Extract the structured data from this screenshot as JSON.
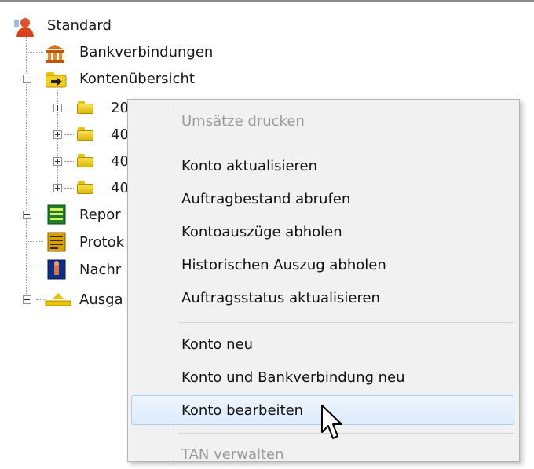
{
  "tree": {
    "root": {
      "label": "Standard",
      "icon": "person-icon"
    },
    "items": [
      {
        "label": "Bankverbindungen",
        "icon": "bank-icon"
      },
      {
        "label": "Kontenübersicht",
        "icon": "folder-arrow-icon"
      },
      {
        "label": "20",
        "icon": "folder-icon"
      },
      {
        "label": "40",
        "icon": "folder-icon"
      },
      {
        "label": "40",
        "icon": "folder-icon"
      },
      {
        "label": "40",
        "icon": "folder-icon"
      },
      {
        "label": "Repor",
        "icon": "report-icon"
      },
      {
        "label": "Protok",
        "icon": "protocol-icon"
      },
      {
        "label": "Nachr",
        "icon": "message-icon"
      },
      {
        "label": "Ausga",
        "icon": "outbox-icon"
      }
    ]
  },
  "context_menu": {
    "items": [
      {
        "label": "Umsätze drucken",
        "state": "disabled"
      },
      {
        "label": "Konto aktualisieren",
        "state": "normal"
      },
      {
        "label": "Auftragbestand abrufen",
        "state": "normal"
      },
      {
        "label": "Kontoauszüge abholen",
        "state": "normal"
      },
      {
        "label": "Historischen Auszug abholen",
        "state": "normal"
      },
      {
        "label": "Auftragsstatus aktualisieren",
        "state": "normal"
      },
      {
        "label": "Konto neu",
        "state": "normal"
      },
      {
        "label": "Konto und Bankverbindung neu",
        "state": "normal"
      },
      {
        "label": "Konto bearbeiten",
        "state": "highlighted"
      },
      {
        "label": "TAN verwalten",
        "state": "disabled"
      }
    ]
  },
  "colors": {
    "highlight": "#dcebfb",
    "highlight_border": "#a8cff3",
    "folder": "#e8c400"
  }
}
